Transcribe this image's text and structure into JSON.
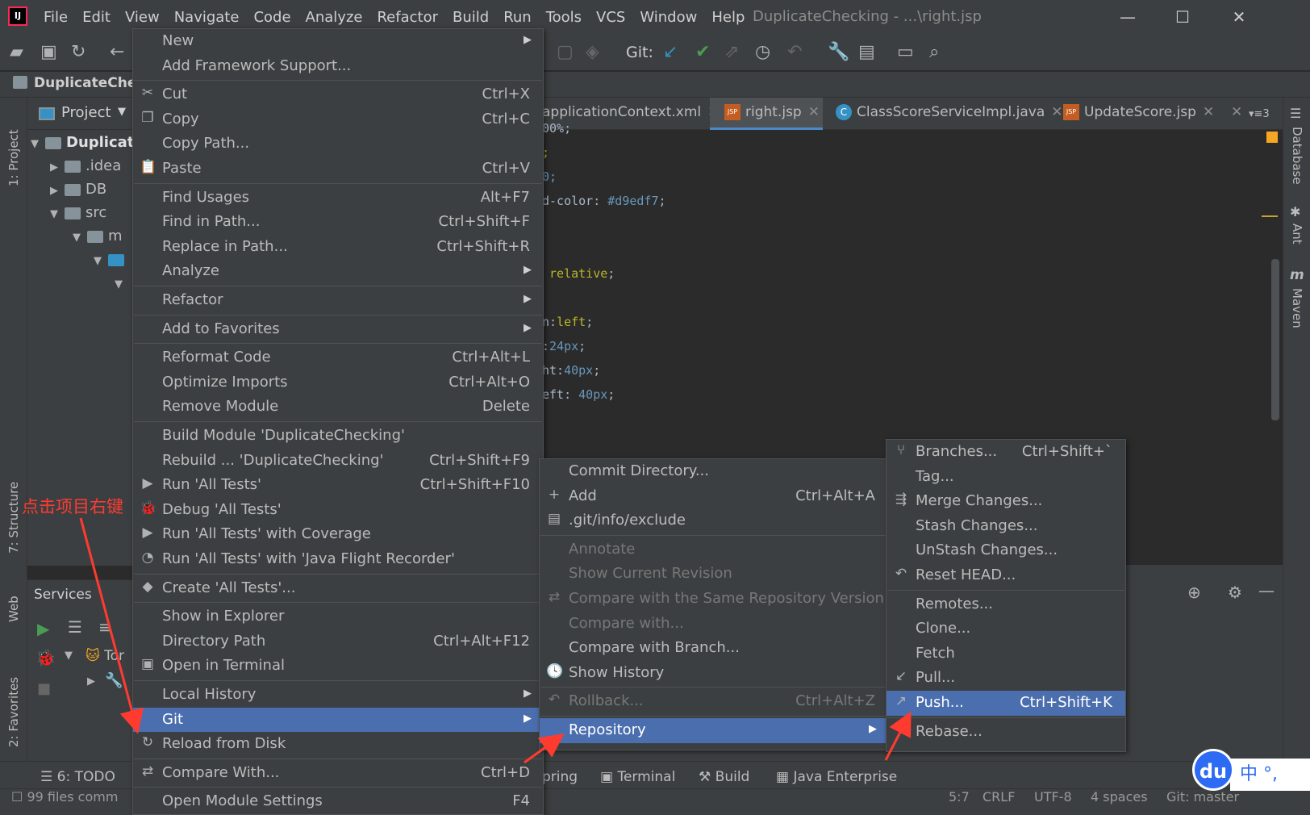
{
  "window": {
    "title": "DuplicateChecking - ...\\right.jsp",
    "logo": "IJ",
    "menu": [
      "File",
      "Edit",
      "View",
      "Navigate",
      "Code",
      "Analyze",
      "Refactor",
      "Build",
      "Run",
      "Tools",
      "VCS",
      "Window",
      "Help"
    ],
    "controls": [
      "—",
      "☐",
      "✕"
    ]
  },
  "toolbar": {
    "git_label": "Git:"
  },
  "navbar": {
    "project": "DuplicateCheck"
  },
  "left_stripe": {
    "project_tab": "1: Project",
    "structure_tab": "7: Structure",
    "web_tab": "Web",
    "favorites_tab": "2: Favorites"
  },
  "right_stripe": {
    "database_tab": "Database",
    "ant_tab": "Ant",
    "maven_tab": "Maven"
  },
  "project_panel": {
    "title": "Project",
    "tree": [
      {
        "label": "Duplicat",
        "bold": true
      },
      {
        "label": ".idea"
      },
      {
        "label": "DB"
      },
      {
        "label": "src"
      },
      {
        "label": "m"
      }
    ]
  },
  "services": {
    "title": "Services",
    "row": "Tor"
  },
  "tabs": [
    {
      "label": "applicationContext.xml"
    },
    {
      "label": "right.jsp",
      "active": true
    },
    {
      "label": "ClassScoreServiceImpl.java"
    },
    {
      "label": "UpdateScore.jsp"
    },
    {
      "label": "3"
    }
  ],
  "code": [
    {
      "text": "00%;",
      "kind": "plain"
    },
    {
      "text": ";",
      "kind": "plain"
    },
    {
      "text": "0;",
      "kind": "num"
    },
    {
      "pre": "d-color: ",
      "val": "#d9edf7",
      "post": ";"
    },
    {
      "pre": " ",
      "val": "relative",
      "post": ";",
      "kw": true
    },
    {
      "pre": "n:",
      "val": "left",
      "post": ";",
      "kw": true
    },
    {
      "pre": ":",
      "val": "24px",
      "post": ";"
    },
    {
      "pre": "ht:",
      "val": "40px",
      "post": ";"
    },
    {
      "pre": "eft: ",
      "val": "40px",
      "post": ";"
    }
  ],
  "context_menu": [
    {
      "label": "New",
      "arrow": true
    },
    {
      "label": "Add Framework Support..."
    },
    {
      "sep": true
    },
    {
      "label": "Cut",
      "shortcut": "Ctrl+X",
      "icon": "✂"
    },
    {
      "label": "Copy",
      "shortcut": "Ctrl+C",
      "icon": "❐"
    },
    {
      "label": "Copy Path..."
    },
    {
      "label": "Paste",
      "shortcut": "Ctrl+V",
      "icon": "📋"
    },
    {
      "sep": true
    },
    {
      "label": "Find Usages",
      "shortcut": "Alt+F7"
    },
    {
      "label": "Find in Path...",
      "shortcut": "Ctrl+Shift+F"
    },
    {
      "label": "Replace in Path...",
      "shortcut": "Ctrl+Shift+R"
    },
    {
      "label": "Analyze",
      "arrow": true
    },
    {
      "sep": true
    },
    {
      "label": "Refactor",
      "arrow": true
    },
    {
      "sep": true
    },
    {
      "label": "Add to Favorites",
      "arrow": true
    },
    {
      "sep": true
    },
    {
      "label": "Reformat Code",
      "shortcut": "Ctrl+Alt+L"
    },
    {
      "label": "Optimize Imports",
      "shortcut": "Ctrl+Alt+O"
    },
    {
      "label": "Remove Module",
      "shortcut": "Delete"
    },
    {
      "sep": true
    },
    {
      "label": "Build Module 'DuplicateChecking'"
    },
    {
      "label": "Rebuild ... 'DuplicateChecking'",
      "shortcut": "Ctrl+Shift+F9"
    },
    {
      "label": "Run 'All Tests'",
      "shortcut": "Ctrl+Shift+F10",
      "icon": "▶"
    },
    {
      "label": "Debug 'All Tests'",
      "icon": "🐞"
    },
    {
      "label": "Run 'All Tests' with Coverage",
      "icon": "▶"
    },
    {
      "label": "Run 'All Tests' with 'Java Flight Recorder'",
      "icon": "◔"
    },
    {
      "sep": true
    },
    {
      "label": "Create 'All Tests'...",
      "icon": "◆"
    },
    {
      "sep": true
    },
    {
      "label": "Show in Explorer"
    },
    {
      "label": "Directory Path",
      "shortcut": "Ctrl+Alt+F12"
    },
    {
      "label": "Open in Terminal",
      "icon": "▣"
    },
    {
      "sep": true
    },
    {
      "label": "Local History",
      "arrow": true
    },
    {
      "label": "Git",
      "arrow": true,
      "selected": true
    },
    {
      "label": "Reload from Disk",
      "icon": "↻"
    },
    {
      "sep": true
    },
    {
      "label": "Compare With...",
      "shortcut": "Ctrl+D",
      "icon": "⇄"
    },
    {
      "sep": true
    },
    {
      "label": "Open Module Settings",
      "shortcut": "F4"
    }
  ],
  "git_menu": [
    {
      "label": "Commit Directory..."
    },
    {
      "label": "Add",
      "shortcut": "Ctrl+Alt+A",
      "icon": "+"
    },
    {
      "label": ".git/info/exclude",
      "icon": "▤"
    },
    {
      "sep": true
    },
    {
      "label": "Annotate",
      "disabled": true
    },
    {
      "label": "Show Current Revision",
      "disabled": true
    },
    {
      "label": "Compare with the Same Repository Version",
      "disabled": true,
      "icon": "⇄"
    },
    {
      "label": "Compare with...",
      "disabled": true
    },
    {
      "label": "Compare with Branch..."
    },
    {
      "label": "Show History",
      "icon": "🕓"
    },
    {
      "sep": true
    },
    {
      "label": "Rollback...",
      "shortcut": "Ctrl+Alt+Z",
      "disabled": true,
      "icon": "↶"
    },
    {
      "sep": true
    },
    {
      "label": "Repository",
      "arrow": true,
      "selected": true
    }
  ],
  "repo_menu": [
    {
      "label": "Branches...",
      "shortcut": "Ctrl+Shift+`",
      "icon": "⑂"
    },
    {
      "label": "Tag..."
    },
    {
      "label": "Merge Changes...",
      "icon": "⇶"
    },
    {
      "label": "Stash Changes..."
    },
    {
      "label": "UnStash Changes..."
    },
    {
      "label": "Reset HEAD...",
      "icon": "↶"
    },
    {
      "sep": true
    },
    {
      "label": "Remotes..."
    },
    {
      "label": "Clone..."
    },
    {
      "label": "Fetch"
    },
    {
      "label": "Pull...",
      "icon": "↙"
    },
    {
      "label": "Push...",
      "shortcut": "Ctrl+Shift+K",
      "selected": true,
      "icon": "↗"
    },
    {
      "sep": true
    },
    {
      "label": "Rebase..."
    }
  ],
  "tool_windows": [
    {
      "label": "6: TODO"
    },
    {
      "label": "pring"
    },
    {
      "label": "Terminal"
    },
    {
      "label": "Build"
    },
    {
      "label": "Java Enterprise"
    }
  ],
  "status": {
    "left": "99 files comm",
    "position": "5:7",
    "line_sep": "CRLF",
    "encoding": "UTF-8",
    "indent": "4 spaces",
    "branch": "Git: master"
  },
  "annotation": {
    "text": "点击项目右键",
    "color": "#ff3b30"
  },
  "ime": {
    "du": "du",
    "text": "中 °,"
  }
}
